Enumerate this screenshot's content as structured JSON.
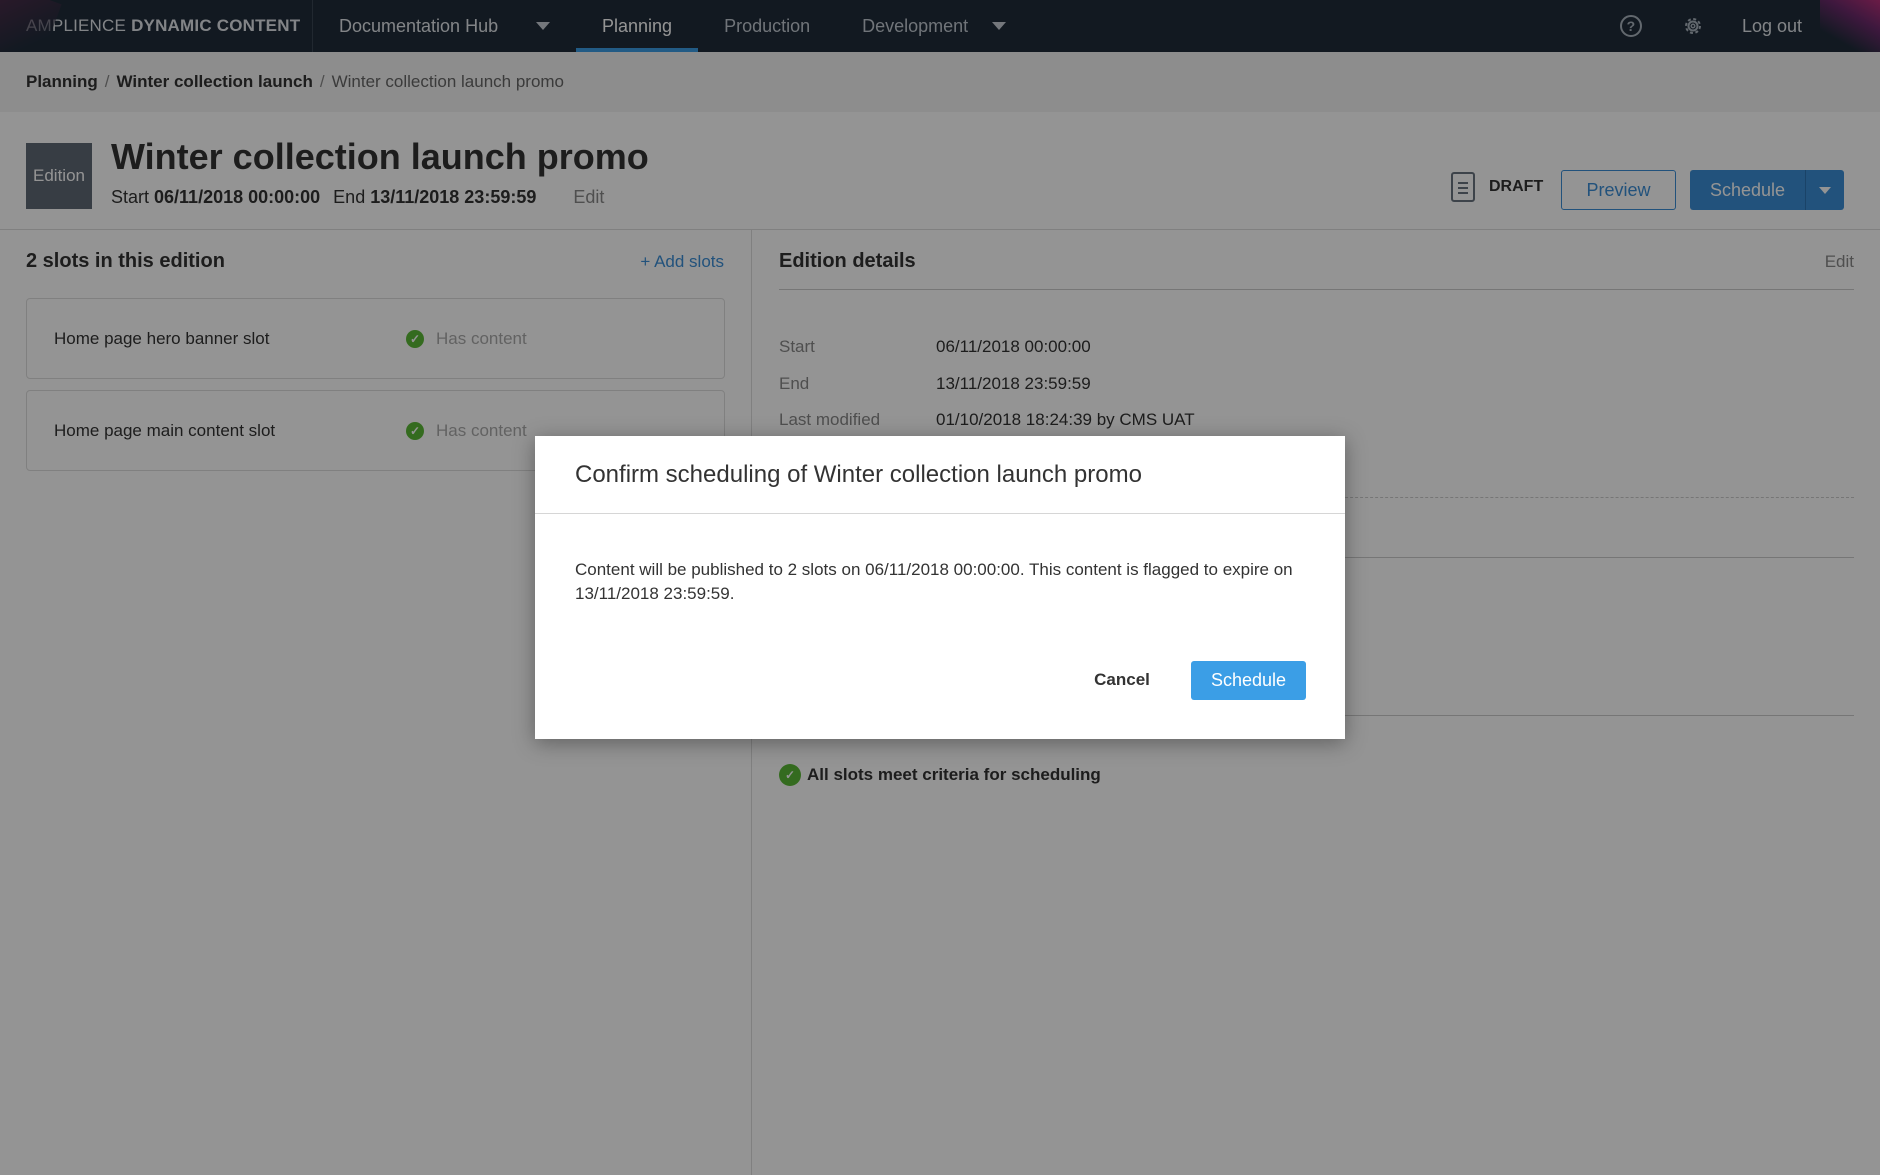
{
  "topbar": {
    "brand_light": "AMPLIENCE",
    "brand_bold": "DYNAMIC CONTENT",
    "hub_label": "Documentation Hub",
    "tabs": [
      {
        "label": "Planning",
        "active": true
      },
      {
        "label": "Production",
        "active": false
      },
      {
        "label": "Development",
        "active": false
      }
    ],
    "help_icon": "?",
    "logout_label": "Log out"
  },
  "breadcrumb": {
    "items": [
      "Planning",
      "Winter collection launch",
      "Winter collection launch promo"
    ],
    "separator": "/"
  },
  "header": {
    "badge": "Edition",
    "title": "Winter collection launch promo",
    "start_label": "Start",
    "start_value": "06/11/2018 00:00:00",
    "end_label": "End",
    "end_value": "13/11/2018 23:59:59",
    "edit_label": "Edit",
    "status": "DRAFT",
    "preview_label": "Preview",
    "schedule_label": "Schedule"
  },
  "slots": {
    "title": "2 slots in this edition",
    "add_label": "+ Add slots",
    "items": [
      {
        "name": "Home page hero banner slot",
        "status": "Has content"
      },
      {
        "name": "Home page main content slot",
        "status": "Has content"
      }
    ]
  },
  "details": {
    "title": "Edition details",
    "edit_label": "Edit",
    "rows": [
      {
        "label": "Start",
        "value": "06/11/2018 00:00:00"
      },
      {
        "label": "End",
        "value": "13/11/2018 23:59:59"
      },
      {
        "label": "Last modified",
        "value": "01/10/2018 18:24:39 by CMS UAT"
      }
    ],
    "criteria": "All slots meet criteria for scheduling"
  },
  "modal": {
    "title": "Confirm scheduling of Winter collection launch promo",
    "body": "Content will be published to 2 slots on 06/11/2018 00:00:00. This content is flagged to expire on 13/11/2018 23:59:59.",
    "cancel_label": "Cancel",
    "confirm_label": "Schedule"
  },
  "colors": {
    "nav_bg": "#1f2c3a",
    "accent": "#3b9ee6",
    "success": "#5ab936"
  }
}
